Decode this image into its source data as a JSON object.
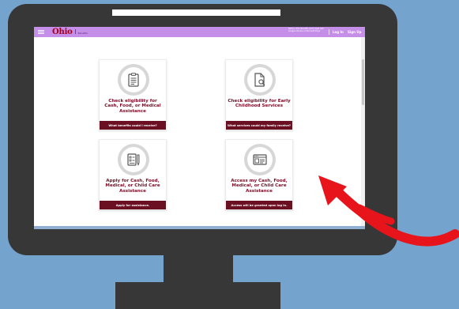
{
  "topbar": {
    "logo_text": "Ohio",
    "logo_subtitle": "Benefits",
    "notice_text": "Notice: Ohio Benefits works best with Google Chrome or Microsoft Edge",
    "login_label": "Log In",
    "signup_label": "Sign Up"
  },
  "cards": [
    {
      "title": "Check eligibility for Cash, Food, or Medical Assistance",
      "footer": "What benefits could I receive?",
      "icon": "clipboard-icon"
    },
    {
      "title": "Check eligibility for Early Childhood Services",
      "footer": "What services could my family receive?",
      "icon": "document-search-icon"
    },
    {
      "title": "Apply for Cash, Food, Medical, or Child Care Assistance",
      "footer": "Apply for assistance.",
      "icon": "checklist-pen-icon"
    },
    {
      "title": "Access my Cash, Food, Medical, or Child Care Assistance",
      "footer": "Access will be granted upon log in.",
      "icon": "browser-id-icon"
    }
  ],
  "colors": {
    "page_background": "#74a3cd",
    "monitor": "#373737",
    "topbar": "#c58ee8",
    "card_title": "#7d0b25",
    "card_footer": "#6b1023",
    "arrow": "#e8141b"
  }
}
